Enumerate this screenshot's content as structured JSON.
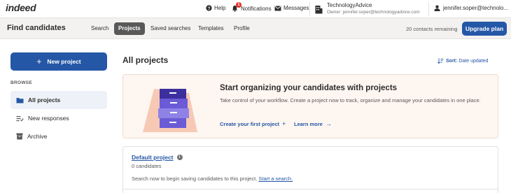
{
  "topbar": {
    "logo": "indeed",
    "help": "Help",
    "notifications": "Notifications",
    "notifications_count": "1",
    "messages": "Messages",
    "company_name": "TechnologyAdvice",
    "company_owner": "Owner: jennifer.soper@technologyadvice.com",
    "user_email": "jennifer.soper@technolo..."
  },
  "subnav": {
    "page_title": "Find candidates",
    "tabs": [
      {
        "label": "Search"
      },
      {
        "label": "Projects",
        "active": true
      },
      {
        "label": "Saved searches"
      },
      {
        "label": "Templates"
      },
      {
        "label": "Profile"
      }
    ],
    "contacts_remaining": "20 contacts remaining",
    "upgrade_label": "Upgrade plan"
  },
  "sidebar": {
    "new_project_label": "New project",
    "browse_label": "BROWSE",
    "items": [
      {
        "label": "All projects",
        "icon": "folder-icon",
        "active": true
      },
      {
        "label": "New responses",
        "icon": "new-responses-icon"
      },
      {
        "label": "Archive",
        "icon": "archive-icon"
      }
    ]
  },
  "main": {
    "title": "All projects",
    "sort_label": "Sort:",
    "sort_value": "Date updated",
    "promo": {
      "title": "Start organizing your candidates with projects",
      "description": "Take control of your workflow. Create a project now to track, organize and manage your candidates in one place.",
      "create_link": "Create your first project",
      "learn_more_link": "Learn more"
    },
    "project": {
      "name": "Default project",
      "count": "0 candidates",
      "empty_text": "Search now to begin saving candidates to this project.",
      "start_search_link": "Start a search."
    }
  },
  "colors": {
    "brand_blue": "#2557a7",
    "promo_bg": "#fef6f0",
    "active_tab_bg": "#595959",
    "sidebar_active_bg": "#eef1f7",
    "folder_icon": "#2557a7",
    "illustration_drawer": "#6b5bd6",
    "illustration_bg": "#f7c9b4"
  }
}
